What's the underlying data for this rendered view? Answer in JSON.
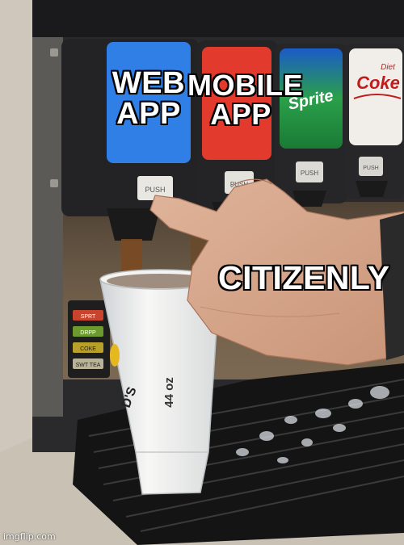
{
  "meme": {
    "captions": {
      "web_line1": "WEB",
      "web_line2": "APP",
      "mobile_line1": "MOBILE",
      "mobile_line2": "APP",
      "citizenly": "CITIZENLY"
    }
  },
  "machine": {
    "buttons": {
      "push_1": "PUSH",
      "push_2": "PUSH",
      "push_3": "PUSH",
      "push_4": "PUSH"
    },
    "brands": {
      "sprite": "Sprite",
      "coke_top": "Diet",
      "coke": "Coke"
    },
    "side_labels": [
      "SPRT",
      "DRPP",
      "COKE",
      "SWT TEA"
    ]
  },
  "cup": {
    "size_label": "44 oz",
    "brand_fragment": "D'S"
  },
  "watermark": "imgflip.com",
  "colors": {
    "panel_blue": "#2f7fe6",
    "panel_red": "#e23a2c",
    "panel_green": "#1f8a3a",
    "panel_white": "#f1eeea",
    "machine_black": "#1c1c1e"
  }
}
